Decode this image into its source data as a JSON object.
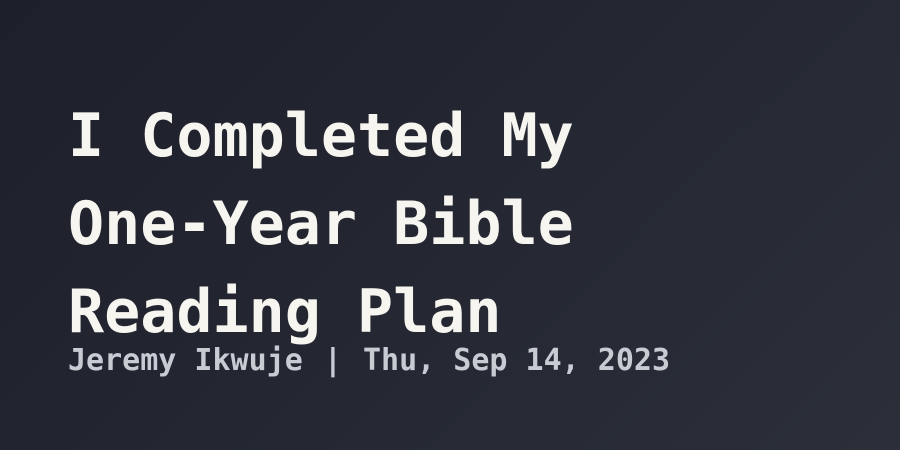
{
  "post": {
    "title_lines": [
      "I Completed My",
      "One-Year Bible",
      "Reading Plan"
    ],
    "author": "Jeremy Ikwuje",
    "separator": "|",
    "date": "Thu, Sep 14, 2023"
  },
  "colors": {
    "background_dark": "#1d1f2a",
    "background_light": "#2c2f39",
    "title_text": "#f6f5ef",
    "byline_text": "#c9cbd3"
  }
}
